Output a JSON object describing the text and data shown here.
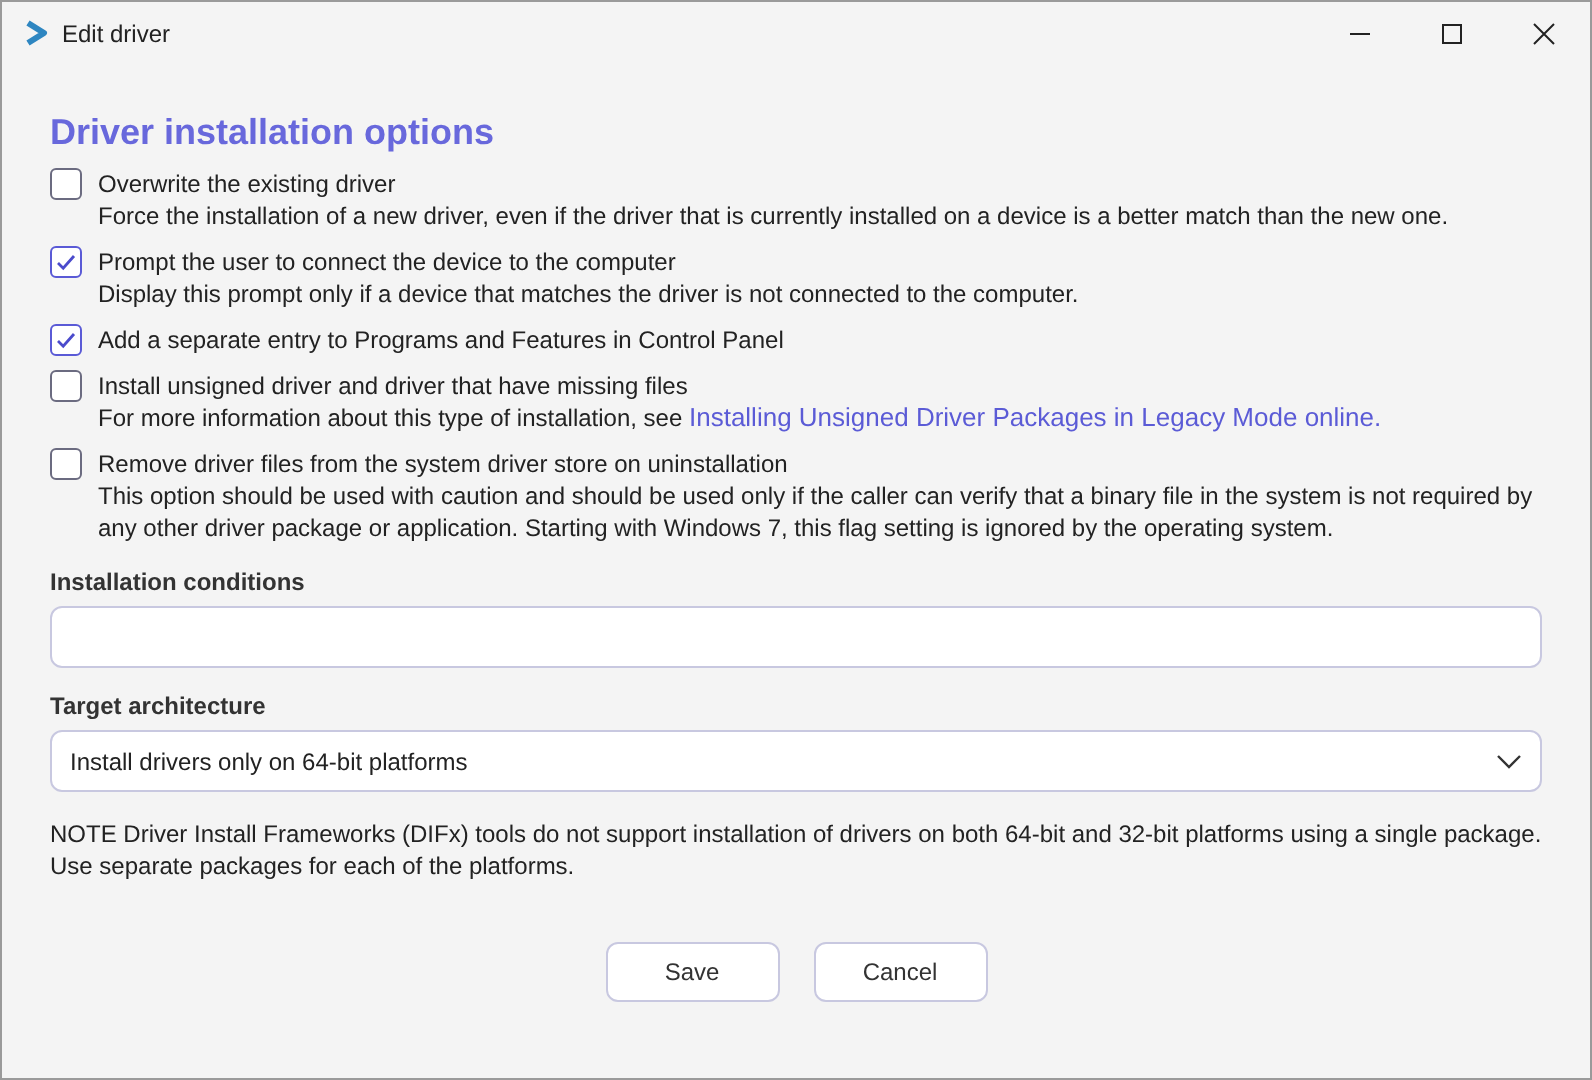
{
  "window": {
    "title": "Edit driver"
  },
  "heading": "Driver installation options",
  "options": [
    {
      "label": "Overwrite the existing driver",
      "checked": false,
      "description": "Force the installation of a new driver, even if the driver that is currently installed on a device is a better match than the new one."
    },
    {
      "label": "Prompt the user to connect the device to the computer",
      "checked": true,
      "description": "Display this prompt only if a device that matches the driver is not connected to the computer."
    },
    {
      "label": "Add a separate entry to Programs and Features in Control Panel",
      "checked": true
    },
    {
      "label": "Install unsigned driver and driver that have missing files",
      "checked": false,
      "description": "For more information about this type of installation, see ",
      "link": "Installing Unsigned Driver Packages in Legacy Mode online."
    },
    {
      "label": "Remove driver files from the system driver store on uninstallation",
      "checked": false,
      "description": "This option should be used with caution and should be used only if the caller can verify that a binary file in the system is not required by any other driver package or application. Starting with Windows 7, this flag setting is ignored by the operating system."
    }
  ],
  "installation_conditions": {
    "label": "Installation conditions"
  },
  "target_architecture": {
    "label": "Target architecture",
    "value": "Install drivers only on 64-bit platforms"
  },
  "note": "NOTE Driver Install Frameworks (DIFx) tools do not support installation of drivers on both 64-bit and 32-bit platforms using a single package. Use separate packages for each of the platforms.",
  "buttons": [
    "Save",
    "Cancel"
  ]
}
